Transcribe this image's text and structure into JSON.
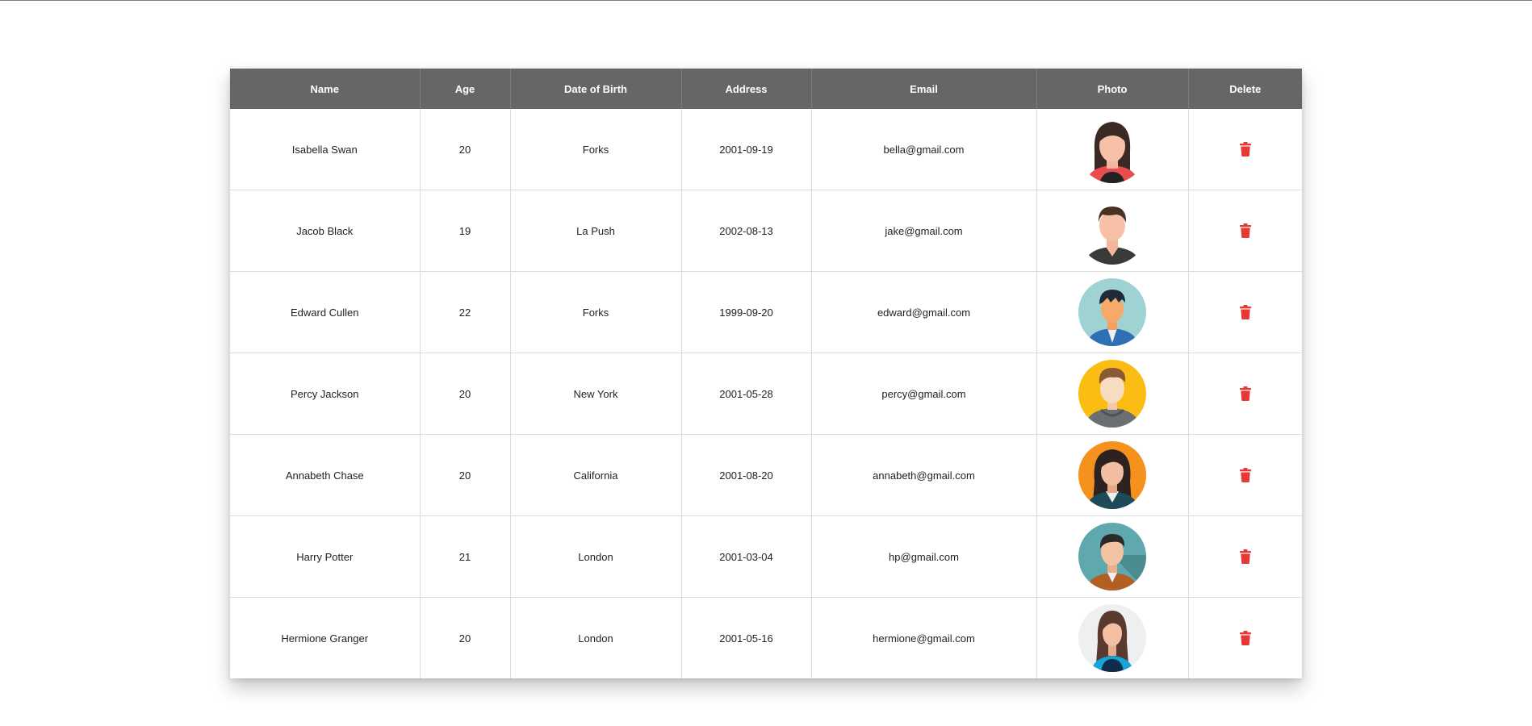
{
  "table": {
    "headers": [
      "Name",
      "Age",
      "Date of Birth",
      "Address",
      "Email",
      "Photo",
      "Delete"
    ],
    "rows": [
      {
        "name": "Isabella Swan",
        "age": "20",
        "col3": "Forks",
        "col4": "2001-09-19",
        "email": "bella@gmail.com",
        "photo": "avatar-woman-dark-hair-red-shirt",
        "delete_icon": "trash-icon"
      },
      {
        "name": "Jacob Black",
        "age": "19",
        "col3": "La Push",
        "col4": "2002-08-13",
        "email": "jake@gmail.com",
        "photo": "avatar-man-dark-shirt",
        "delete_icon": "trash-icon"
      },
      {
        "name": "Edward Cullen",
        "age": "22",
        "col3": "Forks",
        "col4": "1999-09-20",
        "email": "edward@gmail.com",
        "photo": "avatar-man-teal-background-blue-jacket",
        "delete_icon": "trash-icon"
      },
      {
        "name": "Percy Jackson",
        "age": "20",
        "col3": "New York",
        "col4": "2001-05-28",
        "email": "percy@gmail.com",
        "photo": "avatar-man-yellow-background-hoodie",
        "delete_icon": "trash-icon"
      },
      {
        "name": "Annabeth Chase",
        "age": "20",
        "col3": "California",
        "col4": "2001-08-20",
        "email": "annabeth@gmail.com",
        "photo": "avatar-woman-orange-background",
        "delete_icon": "trash-icon"
      },
      {
        "name": "Harry Potter",
        "age": "21",
        "col3": "London",
        "col4": "2001-03-04",
        "email": "hp@gmail.com",
        "photo": "avatar-man-teal-background-brown-jacket",
        "delete_icon": "trash-icon"
      },
      {
        "name": "Hermione Granger",
        "age": "20",
        "col3": "London",
        "col4": "2001-05-16",
        "email": "hermione@gmail.com",
        "photo": "avatar-woman-grey-background-blue-shirt",
        "delete_icon": "trash-icon"
      }
    ]
  },
  "colors": {
    "header_bg": "#666666",
    "header_text": "#ffffff",
    "delete_icon": "#e53935",
    "border": "#dcdcdc"
  }
}
